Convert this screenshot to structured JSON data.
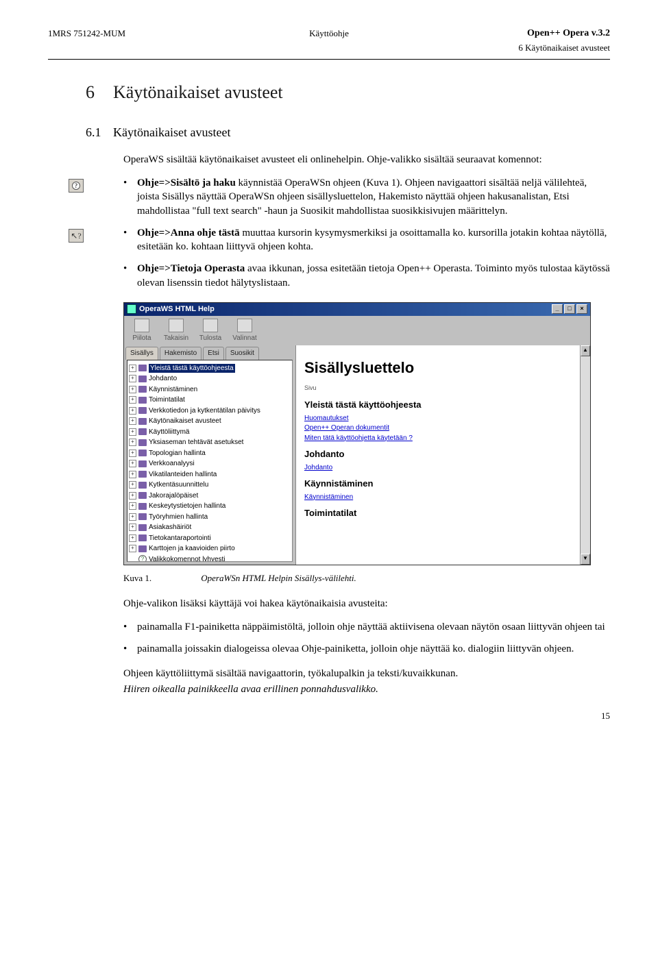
{
  "header": {
    "doc_id": "1MRS 751242-MUM",
    "center": "Käyttöohje",
    "product": "Open++ Opera v.3.2",
    "section_ref": "6 Käytönaikaiset avusteet"
  },
  "h1": {
    "num": "6",
    "title": "Käytönaikaiset avusteet"
  },
  "h2": {
    "num": "6.1",
    "title": "Käytönaikaiset avusteet"
  },
  "intro": "OperaWS sisältää käytönaikaiset avusteet eli onlinehelpin. Ohje-valikko sisältää seuraavat komennot:",
  "bullets_top": [
    "Ohje=>Sisältö ja haku käynnistää OperaWSn ohjeen (Kuva 1). Ohjeen navigaattori sisältää neljä välilehteä, joista Sisällys näyttää OperaWSn ohjeen sisällysluettelon, Hakemisto näyttää ohjeen hakusanalistan, Etsi mahdollistaa \"full text search\" -haun ja Suosikit mahdollistaa suosikkisivujen määrittelyn.",
    "Ohje=>Anna ohje tästä muuttaa kursorin kysymysmerkiksi ja osoittamalla ko. kursorilla jotakin kohtaa näytöllä, esitetään ko. kohtaan liittyvä ohjeen kohta.",
    "Ohje=>Tietoja Operasta avaa ikkunan, jossa esitetään tietoja Open++ Operasta. Toiminto myös tulostaa käytössä olevan lisenssin tiedot hälytyslistaan."
  ],
  "bold_spans": {
    "b0": "Ohje=>Sisältö ja haku",
    "b1": "Ohje=>Anna ohje tästä",
    "b2": "Ohje=>Tietoja Operasta"
  },
  "help_window": {
    "title": "OperaWS HTML Help",
    "toolbar": [
      "Piilota",
      "Takaisin",
      "Tulosta",
      "Valinnat"
    ],
    "tabs": [
      "Sisällys",
      "Hakemisto",
      "Etsi",
      "Suosikit"
    ],
    "tree": [
      "Yleistä tästä käyttöohjeesta",
      "Johdanto",
      "Käynnistäminen",
      "Toimintatilat",
      "Verkkotiedon ja kytkentätilan päivitys",
      "Käytönaikaiset avusteet",
      "Käyttöliittymä",
      "Yksiaseman tehtävät asetukset",
      "Topologian hallinta",
      "Verkkoanalyysi",
      "Vikatilanteiden hallinta",
      "Kytkentäsuunnittelu",
      "Jakorajalöpäiset",
      "Keskeytystietojen hallinta",
      "Työryhmien hallinta",
      "Asiakashäiriöt",
      "Tietokantaraportointi",
      "Karttojen ja kaavioiden piirto"
    ],
    "tree_q": "Valikkokomennot lyhyesti",
    "content": {
      "h1": "Sisällysluettelo",
      "sivu": "Sivu",
      "groups": [
        {
          "h": "Yleistä tästä käyttöohjeesta",
          "links": [
            "Huomautukset",
            "Open++ Operan dokumentit",
            "Miten tätä käyttöohjetta käytetään ?"
          ]
        },
        {
          "h": "Johdanto",
          "links": [
            "Johdanto"
          ]
        },
        {
          "h": "Käynnistäminen",
          "links": [
            "Käynnistäminen"
          ]
        },
        {
          "h": "Toimintatilat",
          "links": []
        }
      ]
    }
  },
  "caption": {
    "label": "Kuva 1.",
    "text": "OperaWSn HTML Helpin Sisällys-välilehti."
  },
  "after_fig_p": "Ohje-valikon lisäksi käyttäjä voi hakea käytönaikaisia avusteita:",
  "bullets_bottom": [
    "painamalla F1-painiketta näppäimistöltä, jolloin ohje näyttää aktiivisena olevaan näytön osaan liittyvän ohjeen tai",
    "painamalla joissakin dialogeissa olevaa Ohje-painiketta, jolloin ohje näyttää ko. dialogiin liittyvän ohjeen."
  ],
  "closing": {
    "p1": "Ohjeen käyttöliittymä sisältää navigaattorin, työkalupalkin ja teksti/kuvaikkunan.",
    "p2_italic": "Hiiren oikealla painikkeella avaa erillinen ponnahdusvalikko."
  },
  "page_num": "15"
}
